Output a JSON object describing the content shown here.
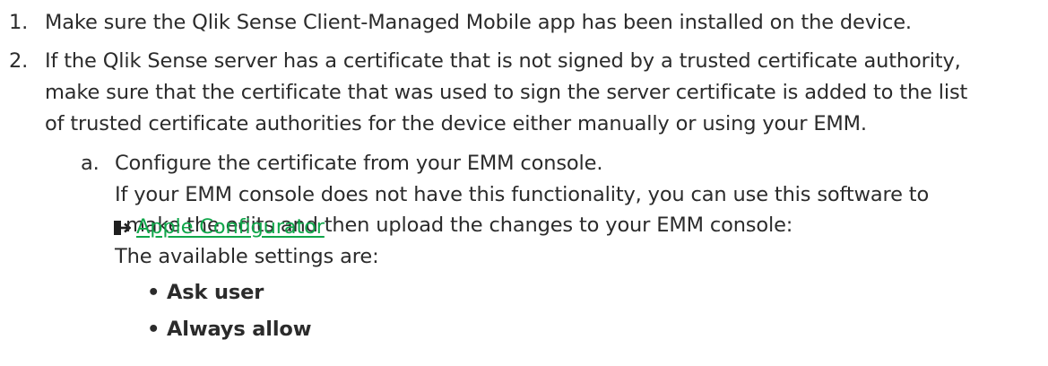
{
  "steps": [
    {
      "number": "1.",
      "lines": [
        "Make sure the Qlik Sense Client-Managed Mobile app has been installed on the device."
      ]
    },
    {
      "number": "2.",
      "lines": [
        "If the Qlik Sense server has a certificate that is not signed by a trusted certificate authority,",
        "make sure that the certificate that was used to sign the server certificate is added to the list",
        "of trusted certificate authorities for the device either manually or using your EMM."
      ]
    }
  ],
  "substep": {
    "letter": "a.",
    "line1": "Configure the certificate from your EMM console.",
    "line2": "If your EMM console does not have this functionality, you can use this software to",
    "line3_text": "make the edits and then upload the changes to your EMM console:",
    "link_text": "Apple Configurator",
    "line4": "The available settings are:"
  },
  "settings": {
    "bullet": "•",
    "items": [
      "Ask user",
      "Always allow"
    ]
  },
  "colors": {
    "text": "#2b2b2b",
    "link": "#10a64a"
  },
  "icons": {
    "external_link": "external-link-icon"
  }
}
